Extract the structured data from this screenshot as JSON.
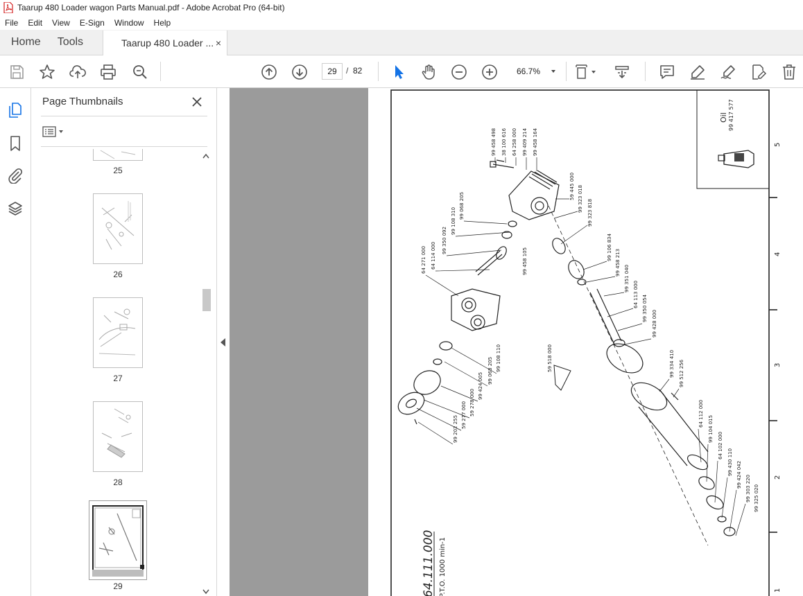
{
  "window": {
    "title": "Taarup 480 Loader wagon Parts Manual.pdf - Adobe Acrobat Pro (64-bit)"
  },
  "menu": [
    "File",
    "Edit",
    "View",
    "E-Sign",
    "Window",
    "Help"
  ],
  "tabs": {
    "home": "Home",
    "tools": "Tools",
    "document": "Taarup 480 Loader ...",
    "close": "×"
  },
  "toolbar": {
    "page_current": "29",
    "page_sep": "/",
    "page_total": "82",
    "zoom": "66.7%"
  },
  "panel": {
    "title": "Page Thumbnails",
    "thumbnails": [
      "25",
      "26",
      "27",
      "28",
      "29"
    ]
  },
  "drawing": {
    "title": "64.111.000",
    "subtitle": "P.T.O. 1000 min-1",
    "oil_label": "Oil",
    "oil_part": "99 417 577",
    "ruler": [
      "5",
      "4",
      "3",
      "2",
      "1"
    ],
    "parts": [
      "99 458 498",
      "38 100 616",
      "64 258 000",
      "99 409 214",
      "99 458 164",
      "59 445 000",
      "99 323 018",
      "99 323 818",
      "99 458 105",
      "99 068 205",
      "99 108 310",
      "99 350 092",
      "64 114 000",
      "64 271 000",
      "99 106 834",
      "99 458 213",
      "99 351 040",
      "64 113 000",
      "99 350 054",
      "99 428 000",
      "59 518 000",
      "99 334 410",
      "99 512 256",
      "64 112 000",
      "99 104 015",
      "64 102 000",
      "99 430 110",
      "99 424 042",
      "99 303 220",
      "99 325 020",
      "99 108 110",
      "99 068 205",
      "99 424 005",
      "59 278 000",
      "59 277 000",
      "99 202 255"
    ]
  },
  "colors": {
    "accent": "#1473e6",
    "docbg": "#9b9b9b"
  }
}
